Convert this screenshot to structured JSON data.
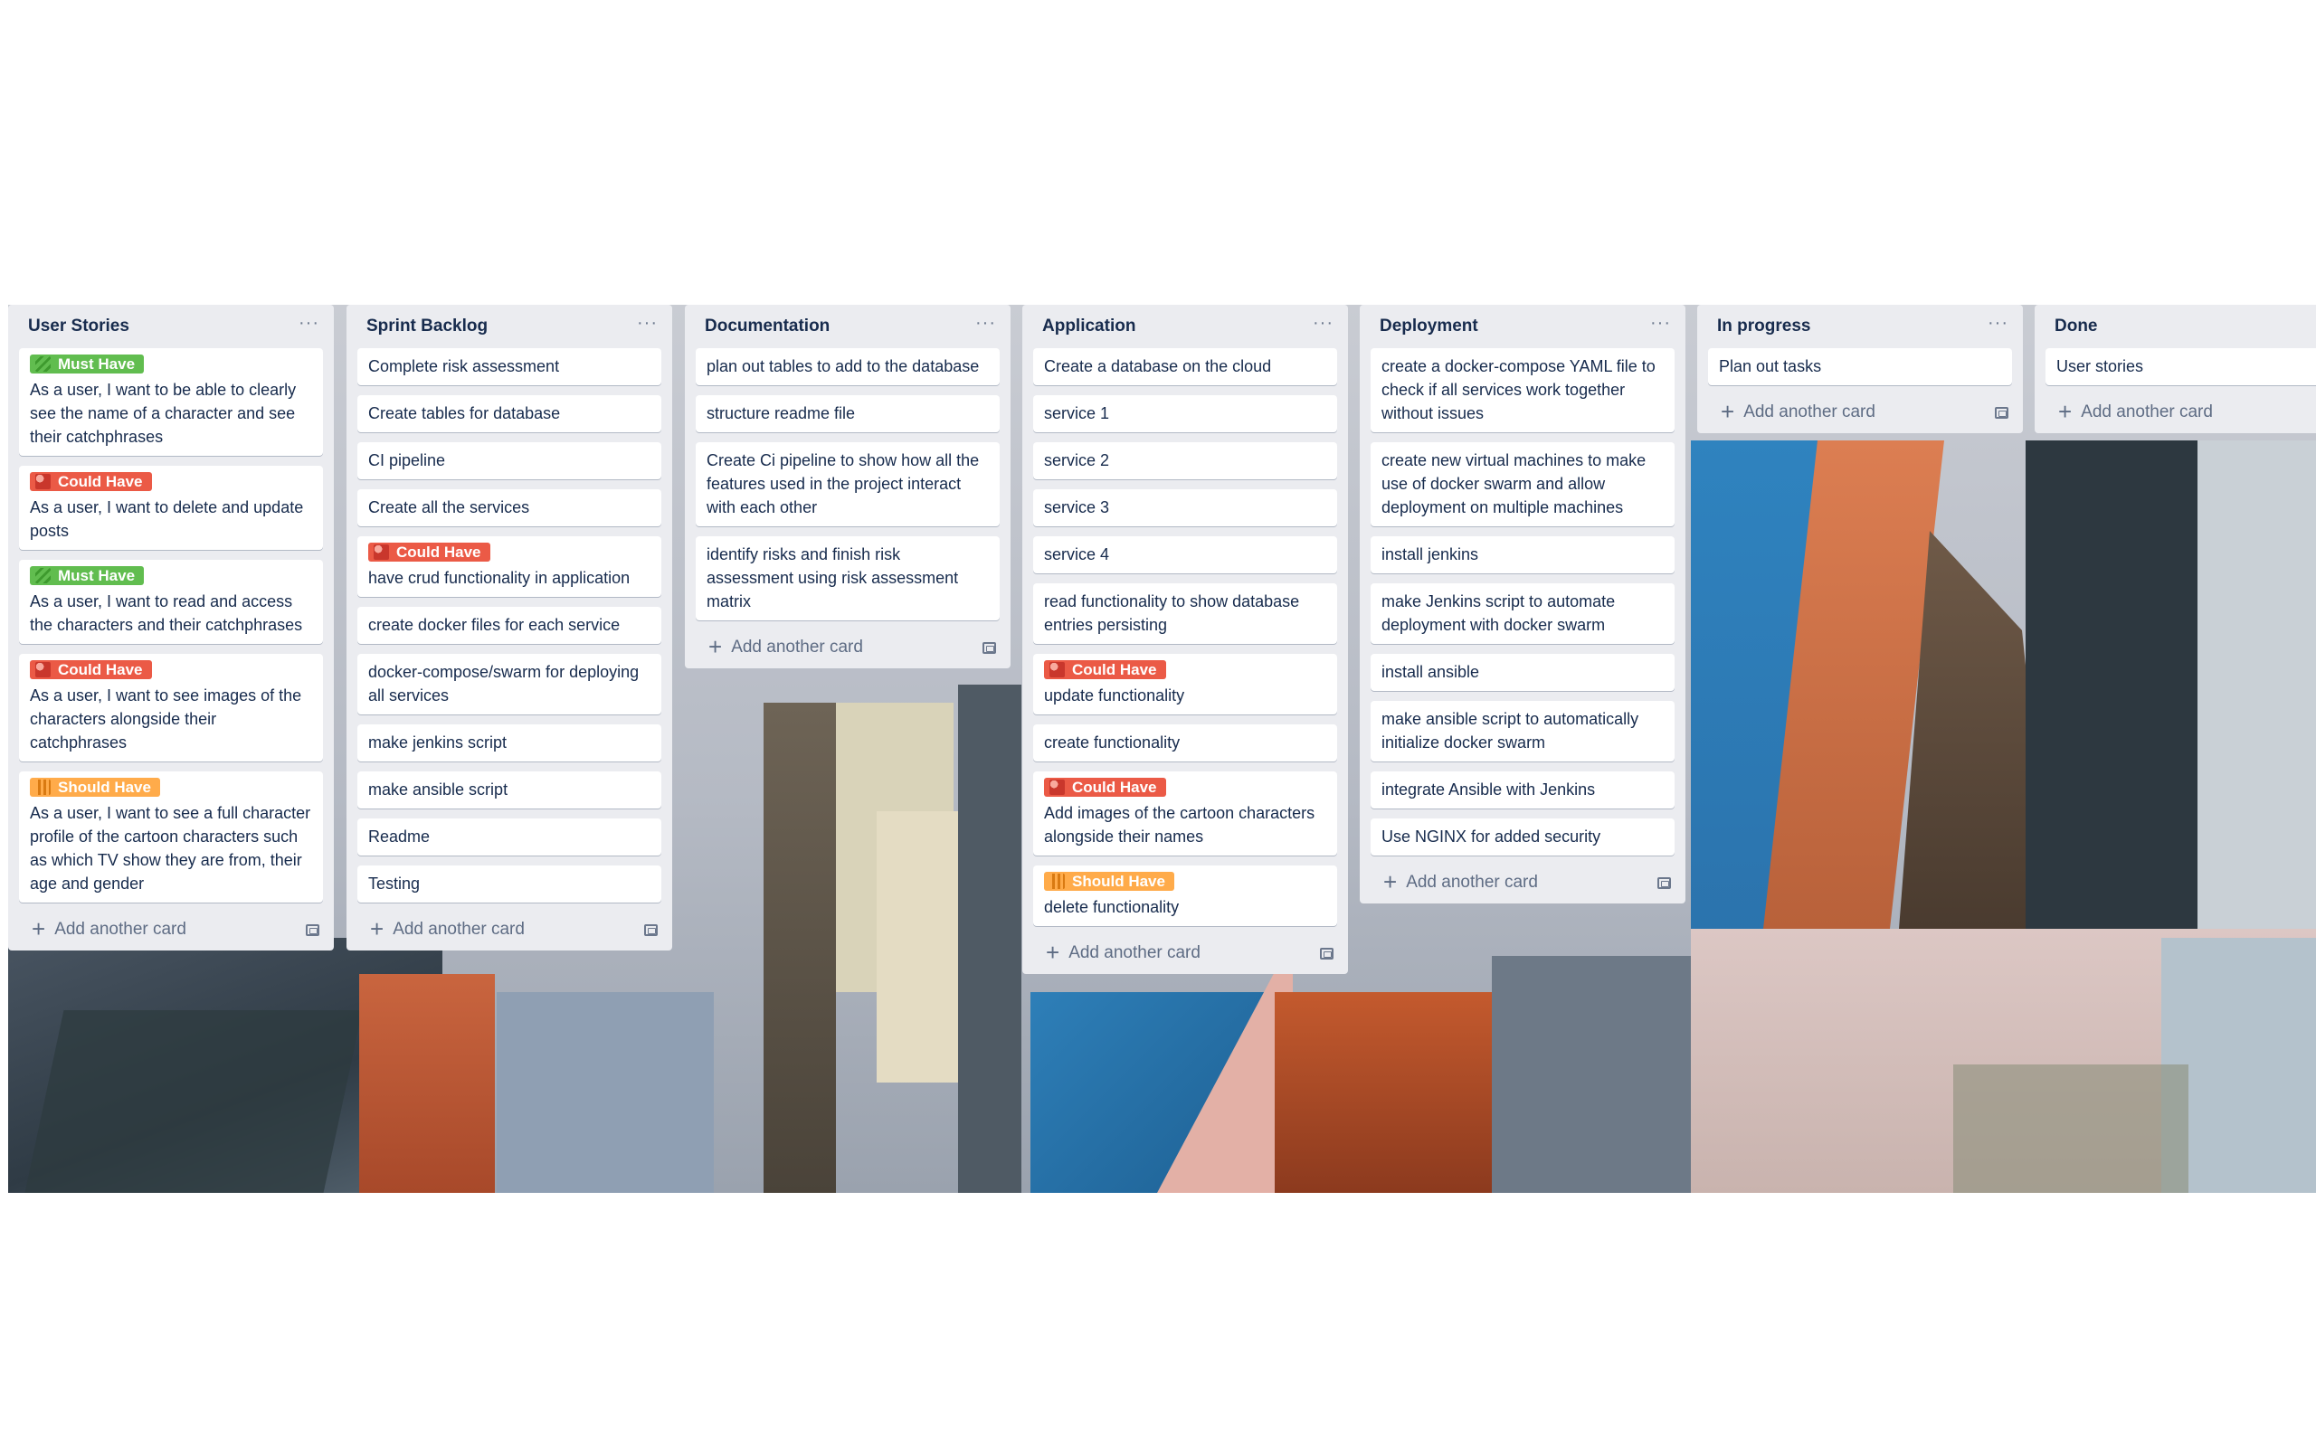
{
  "board": {
    "lists": [
      {
        "title": "User Stories",
        "menu": "···",
        "add_label": "Add another card",
        "cards": [
          {
            "label": "Must Have",
            "text": "As a user, I want to be able to clearly see the name of a character and see their catchphrases"
          },
          {
            "label": "Could Have",
            "text": "As a user, I want to delete and update posts"
          },
          {
            "label": "Must Have",
            "text": "As a user, I want to read and access the characters and their catchphrases"
          },
          {
            "label": "Could Have",
            "text": "As a user, I want to see images of the characters alongside their catchphrases"
          },
          {
            "label": "Should Have",
            "text": "As a user, I want to see a full character profile of the cartoon characters such as which TV show they are from, their age and gender"
          }
        ]
      },
      {
        "title": "Sprint Backlog",
        "menu": "···",
        "add_label": "Add another card",
        "cards": [
          {
            "text": "Complete risk assessment"
          },
          {
            "text": "Create tables for database"
          },
          {
            "text": "CI pipeline"
          },
          {
            "text": "Create all the services"
          },
          {
            "label": "Could Have",
            "text": "have crud functionality in application"
          },
          {
            "text": "create docker files for each service"
          },
          {
            "text": "docker-compose/swarm for deploying all services"
          },
          {
            "text": "make jenkins script"
          },
          {
            "text": "make ansible script"
          },
          {
            "text": "Readme"
          },
          {
            "text": "Testing"
          }
        ]
      },
      {
        "title": "Documentation",
        "menu": "···",
        "add_label": "Add another card",
        "cards": [
          {
            "text": "plan out tables to add to the database"
          },
          {
            "text": "structure readme file"
          },
          {
            "text": "Create Ci pipeline to show how all the features used in the project interact with each other"
          },
          {
            "text": "identify risks and finish risk assessment using risk assessment matrix"
          }
        ]
      },
      {
        "title": "Application",
        "menu": "···",
        "add_label": "Add another card",
        "cards": [
          {
            "text": "Create a database on the cloud"
          },
          {
            "text": "service 1"
          },
          {
            "text": "service 2"
          },
          {
            "text": "service 3"
          },
          {
            "text": "service 4"
          },
          {
            "text": "read functionality to show database entries persisting"
          },
          {
            "label": "Could Have",
            "text": "update functionality"
          },
          {
            "text": "create functionality"
          },
          {
            "label": "Could Have",
            "text": "Add images of the cartoon characters alongside their names"
          },
          {
            "label": "Should Have",
            "text": "delete functionality"
          }
        ]
      },
      {
        "title": "Deployment",
        "menu": "···",
        "add_label": "Add another card",
        "cards": [
          {
            "text": "create a docker-compose YAML file to check if all services work together without issues"
          },
          {
            "text": "create new virtual machines to make use of docker swarm and allow deployment on multiple machines"
          },
          {
            "text": "install jenkins"
          },
          {
            "text": "make Jenkins script to automate deployment with docker swarm"
          },
          {
            "text": "install ansible"
          },
          {
            "text": "make ansible script to automatically initialize docker swarm"
          },
          {
            "text": "integrate Ansible with Jenkins"
          },
          {
            "text": "Use NGINX for added security"
          }
        ]
      },
      {
        "title": "In progress",
        "menu": "···",
        "add_label": "Add another card",
        "cards": [
          {
            "text": "Plan out tasks"
          }
        ]
      },
      {
        "title": "Done",
        "menu": "",
        "add_label": "Add another card",
        "cards": [
          {
            "text": "User stories"
          }
        ]
      }
    ]
  },
  "label_colors": {
    "Must Have": "#61bd4f",
    "Could Have": "#eb5a46",
    "Should Have": "#ffab4a"
  },
  "icons": {
    "list_menu": "ellipsis-icon",
    "add": "plus-icon",
    "template": "card-template-icon"
  }
}
